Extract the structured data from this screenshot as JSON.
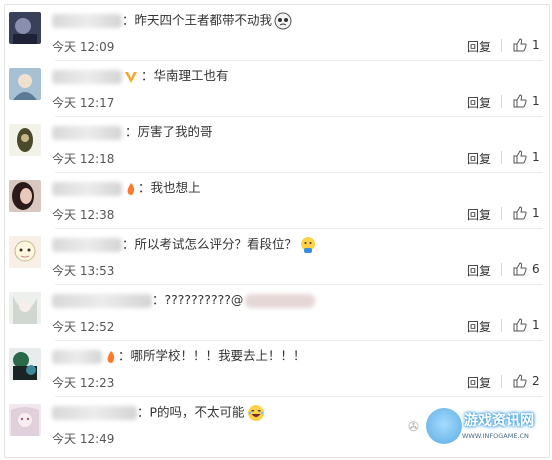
{
  "comments": [
    {
      "text": "：昨天四个王者都带不动我",
      "time": "今天 12:09",
      "reply": "回复",
      "likes": "1",
      "avatar_color": "#3a3f5a"
    },
    {
      "text": "：华南理工也有",
      "time": "今天 12:17",
      "reply": "回复",
      "likes": "1",
      "avatar_color": "#7a9bb8"
    },
    {
      "text": "：厉害了我的哥",
      "time": "今天 12:18",
      "reply": "回复",
      "likes": "1",
      "avatar_color": "#4a4a2a"
    },
    {
      "text": "：我也想上",
      "time": "今天 12:38",
      "reply": "回复",
      "likes": "1",
      "avatar_color": "#6a4a4a"
    },
    {
      "text": "：所以考试怎么评分？看段位？",
      "time": "今天 13:53",
      "reply": "回复",
      "likes": "6",
      "avatar_color": "#e8e0d0"
    },
    {
      "text": "：??????????@",
      "time": "今天 12:52",
      "reply": "回复",
      "likes": "1",
      "avatar_color": "#d8dcd8"
    },
    {
      "text": "：哪所学校！！！我要去上！！！",
      "time": "今天 12:23",
      "reply": "回复",
      "likes": "2",
      "avatar_color": "#2a3a3a"
    },
    {
      "text": "：P的吗，不太可能",
      "time": "今天 12:49",
      "reply": "",
      "likes": "",
      "avatar_color": "#e6d8e0"
    }
  ],
  "watermark": {
    "title": "游戏资讯网",
    "subtitle": "WWW.INFOGAME.CN"
  }
}
